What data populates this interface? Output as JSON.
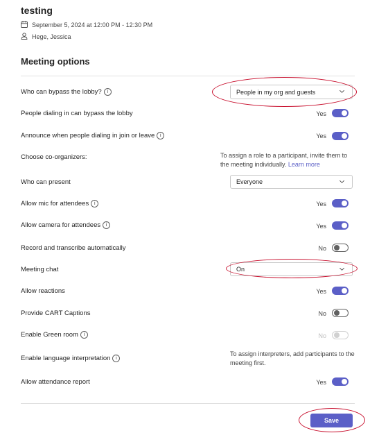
{
  "meeting": {
    "title": "testing",
    "datetime": "September 5, 2024 at 12:00 PM - 12:30 PM",
    "organizers": "Hege, Jessica",
    "icons": {
      "calendar": "calendar-icon",
      "person": "person-icon"
    }
  },
  "section_title": "Meeting options",
  "options": {
    "bypass_lobby": {
      "label": "Who can bypass the lobby?",
      "value": "People in my org and guests"
    },
    "dial_bypass": {
      "label": "People dialing in can bypass the lobby",
      "state": "Yes",
      "on": true
    },
    "announce": {
      "label": "Announce when people dialing in join or leave",
      "state": "Yes",
      "on": true
    },
    "coorganizers": {
      "label": "Choose co-organizers:",
      "note": "To assign a role to a participant, invite them to the meeting individually.",
      "link": "Learn more"
    },
    "present": {
      "label": "Who can present",
      "value": "Everyone"
    },
    "mic": {
      "label": "Allow mic for attendees",
      "state": "Yes",
      "on": true
    },
    "camera": {
      "label": "Allow camera for attendees",
      "state": "Yes",
      "on": true
    },
    "record": {
      "label": "Record and transcribe automatically",
      "state": "No",
      "on": false
    },
    "chat": {
      "label": "Meeting chat",
      "value": "On"
    },
    "reactions": {
      "label": "Allow reactions",
      "state": "Yes",
      "on": true
    },
    "cart": {
      "label": "Provide CART Captions",
      "state": "No",
      "on": false
    },
    "green_room": {
      "label": "Enable Green room",
      "state": "No",
      "on": false,
      "disabled": true
    },
    "interpretation": {
      "label": "Enable language interpretation",
      "note": "To assign interpreters, add participants to the meeting first."
    },
    "attendance": {
      "label": "Allow attendance report",
      "state": "Yes",
      "on": true
    }
  },
  "save_label": "Save",
  "colors": {
    "accent": "#5b5fc7",
    "annotation": "#c8102e"
  }
}
